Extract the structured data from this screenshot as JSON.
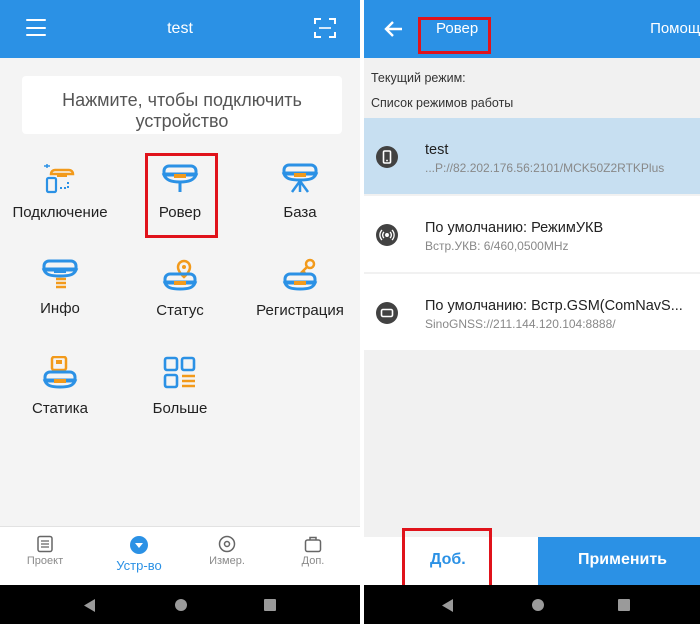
{
  "left": {
    "app_bar": {
      "title": "test"
    },
    "connect_prompt": "Нажмите, чтобы подключить устройство",
    "tiles": [
      {
        "label": "Подключение",
        "icon": "connection-icon"
      },
      {
        "label": "Ровер",
        "icon": "rover-receiver-icon"
      },
      {
        "label": "База",
        "icon": "base-station-icon"
      },
      {
        "label": "Инфо",
        "icon": "info-receiver-icon"
      },
      {
        "label": "Статус",
        "icon": "status-location-icon"
      },
      {
        "label": "Регистрация",
        "icon": "registration-key-icon"
      },
      {
        "label": "Статика",
        "icon": "static-recording-icon"
      },
      {
        "label": "Больше",
        "icon": "more-grid-icon"
      }
    ],
    "bottom_nav": [
      {
        "label": "Проект",
        "icon": "project-icon",
        "active": false
      },
      {
        "label": "Устр-во",
        "icon": "device-icon",
        "active": true
      },
      {
        "label": "Измер.",
        "icon": "measure-icon",
        "active": false
      },
      {
        "label": "Доп.",
        "icon": "extra-icon",
        "active": false
      }
    ]
  },
  "right": {
    "app_bar": {
      "title": "Ровер",
      "help": "Помощь"
    },
    "current_mode_label": "Текущий режим:",
    "mode_list_label": "Список режимов работы",
    "modes": [
      {
        "title": "test",
        "subtitle": "...P://82.202.176.56:2101/MCK50Z2RTKPlus",
        "icon": "phone-network-icon",
        "selected": true
      },
      {
        "title": "По умолчанию: РежимУКВ",
        "subtitle": "Встр.УКВ: 6/460,0500MHz",
        "icon": "radio-icon",
        "selected": false
      },
      {
        "title": "По умолчанию: Встр.GSM(ComNavS...",
        "subtitle": "SinoGNSS://211.144.120.104:8888/",
        "icon": "gsm-icon",
        "selected": false
      }
    ],
    "footer": {
      "add_label": "Доб.",
      "apply_label": "Применить"
    }
  },
  "colors": {
    "accent": "#2b91e5",
    "icon_orange": "#f29a1b",
    "highlight_box": "#e0131b",
    "selected_row": "#c7dff1"
  }
}
